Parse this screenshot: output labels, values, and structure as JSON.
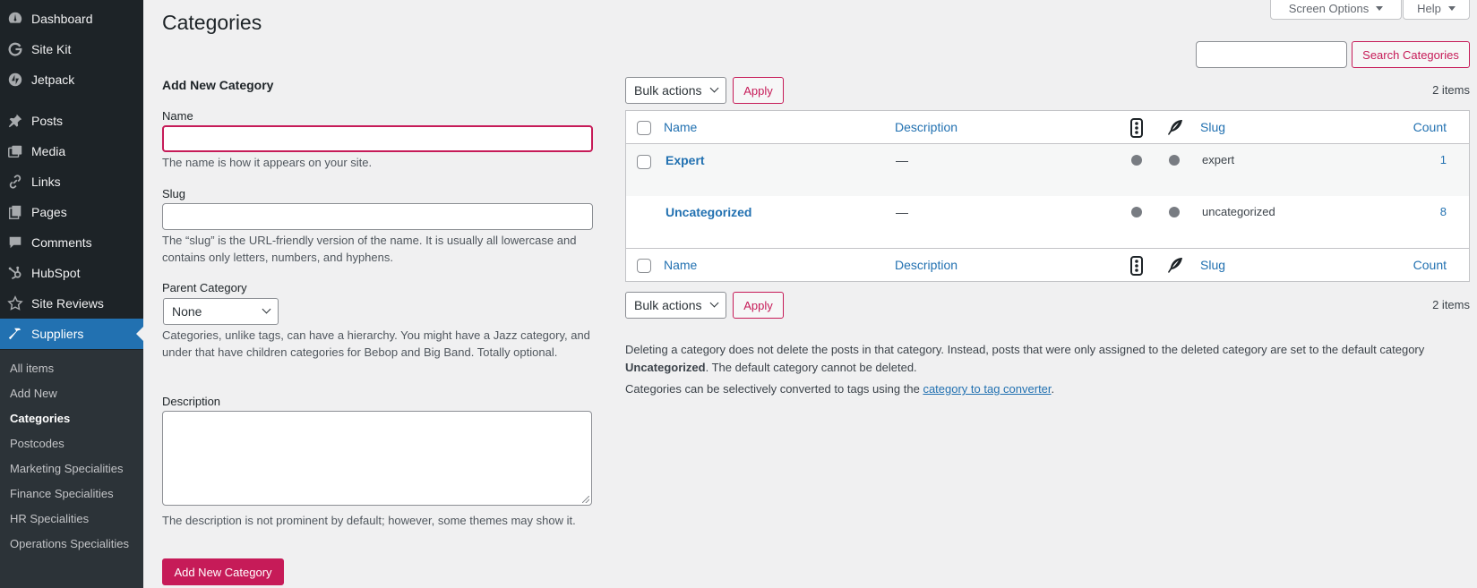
{
  "sidebar": {
    "menu": [
      {
        "label": "Dashboard",
        "icon": "dashboard-icon"
      },
      {
        "label": "Site Kit",
        "icon": "google-g-icon"
      },
      {
        "label": "Jetpack",
        "icon": "jetpack-icon"
      },
      {
        "label": "Posts",
        "icon": "pushpin-icon"
      },
      {
        "label": "Media",
        "icon": "media-icon"
      },
      {
        "label": "Links",
        "icon": "link-icon"
      },
      {
        "label": "Pages",
        "icon": "pages-icon"
      },
      {
        "label": "Comments",
        "icon": "comment-icon"
      },
      {
        "label": "HubSpot",
        "icon": "hubspot-icon"
      },
      {
        "label": "Site Reviews",
        "icon": "star-icon"
      },
      {
        "label": "Suppliers",
        "icon": "hammer-icon",
        "active": true
      }
    ],
    "submenu": [
      {
        "label": "All items"
      },
      {
        "label": "Add New"
      },
      {
        "label": "Categories",
        "current": true
      },
      {
        "label": "Postcodes"
      },
      {
        "label": "Marketing Specialities"
      },
      {
        "label": "Finance Specialities"
      },
      {
        "label": "HR Specialities"
      },
      {
        "label": "Operations Specialities"
      }
    ]
  },
  "header": {
    "title": "Categories",
    "screen_options": "Screen Options",
    "help": "Help"
  },
  "search": {
    "value": "",
    "button": "Search Categories"
  },
  "form": {
    "heading": "Add New Category",
    "name_label": "Name",
    "name_value": "",
    "name_desc": "The name is how it appears on your site.",
    "slug_label": "Slug",
    "slug_value": "",
    "slug_desc": "The “slug” is the URL-friendly version of the name. It is usually all lowercase and contains only letters, numbers, and hyphens.",
    "parent_label": "Parent Category",
    "parent_value": "None",
    "parent_desc": "Categories, unlike tags, can have a hierarchy. You might have a Jazz category, and under that have children categories for Bebop and Big Band. Totally optional.",
    "description_label": "Description",
    "description_value": "",
    "description_desc": "The description is not prominent by default; however, some themes may show it.",
    "submit": "Add New Category"
  },
  "table": {
    "bulk_actions": "Bulk actions",
    "apply": "Apply",
    "items_count": "2 items",
    "columns": {
      "name": "Name",
      "description": "Description",
      "slug": "Slug",
      "count": "Count"
    },
    "column_icons": [
      "traffic-light-icon",
      "feather-icon"
    ],
    "rows": [
      {
        "name": "Expert",
        "description": "—",
        "slug": "expert",
        "count": "1",
        "has_checkbox": true
      },
      {
        "name": "Uncategorized",
        "description": "—",
        "slug": "uncategorized",
        "count": "8",
        "has_checkbox": false
      }
    ]
  },
  "notes": {
    "p1_before": "Deleting a category does not delete the posts in that category. Instead, posts that were only assigned to the deleted category are set to the default category",
    "p1_bold": "Uncategorized",
    "p1_after": ". The default category cannot be deleted.",
    "p2_before": "Categories can be selectively converted to tags using the",
    "p2_link": "category to tag converter",
    "p2_after": "."
  },
  "colors": {
    "sidebar_bg": "#1d2327",
    "active_menu": "#2271b1",
    "accent": "#c61b58",
    "link": "#2271b1"
  }
}
